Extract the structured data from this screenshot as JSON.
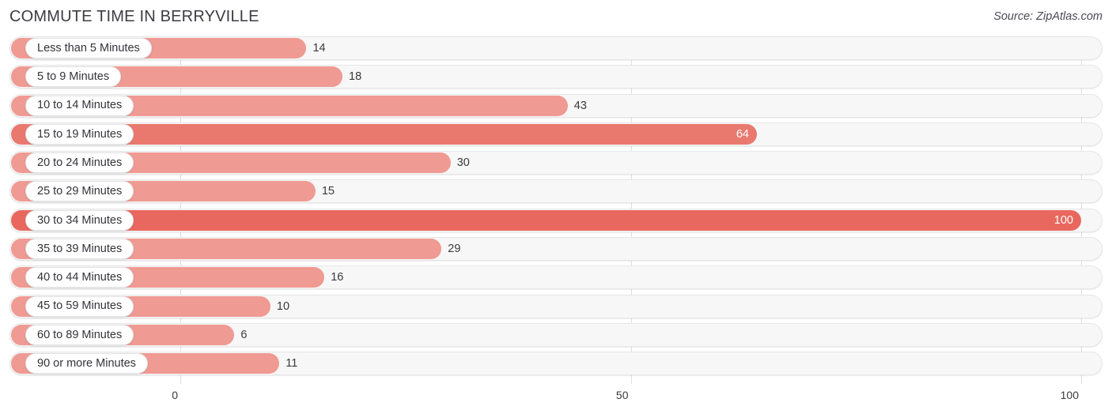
{
  "header": {
    "title": "COMMUTE TIME IN BERRYVILLE",
    "source": "Source: ZipAtlas.com"
  },
  "colors": {
    "bar_light": "#ef9a93",
    "bar_high": "#e9796f",
    "bar_max": "#e8685f",
    "track": "#f7f7f7",
    "gridline": "#dedede",
    "text": "#3a3a3a",
    "value_inside": "#ffffff"
  },
  "chart_data": {
    "type": "bar",
    "orientation": "horizontal",
    "title": "COMMUTE TIME IN BERRYVILLE",
    "xlabel": "",
    "ylabel": "",
    "xlim": [
      0,
      100
    ],
    "grid": true,
    "legend": null,
    "axis_ticks": [
      "0",
      "50",
      "100"
    ],
    "axis_tick_values": [
      0,
      50,
      100
    ],
    "categories": [
      "Less than 5 Minutes",
      "5 to 9 Minutes",
      "10 to 14 Minutes",
      "15 to 19 Minutes",
      "20 to 24 Minutes",
      "25 to 29 Minutes",
      "30 to 34 Minutes",
      "35 to 39 Minutes",
      "40 to 44 Minutes",
      "45 to 59 Minutes",
      "60 to 89 Minutes",
      "90 or more Minutes"
    ],
    "values": [
      14,
      18,
      43,
      64,
      30,
      15,
      100,
      29,
      16,
      10,
      6,
      11
    ],
    "value_labels": [
      "14",
      "18",
      "43",
      "64",
      "30",
      "15",
      "100",
      "29",
      "16",
      "10",
      "6",
      "11"
    ],
    "label_position": [
      "outside",
      "outside",
      "outside",
      "inside",
      "outside",
      "outside",
      "inside",
      "outside",
      "outside",
      "outside",
      "outside",
      "outside"
    ]
  }
}
